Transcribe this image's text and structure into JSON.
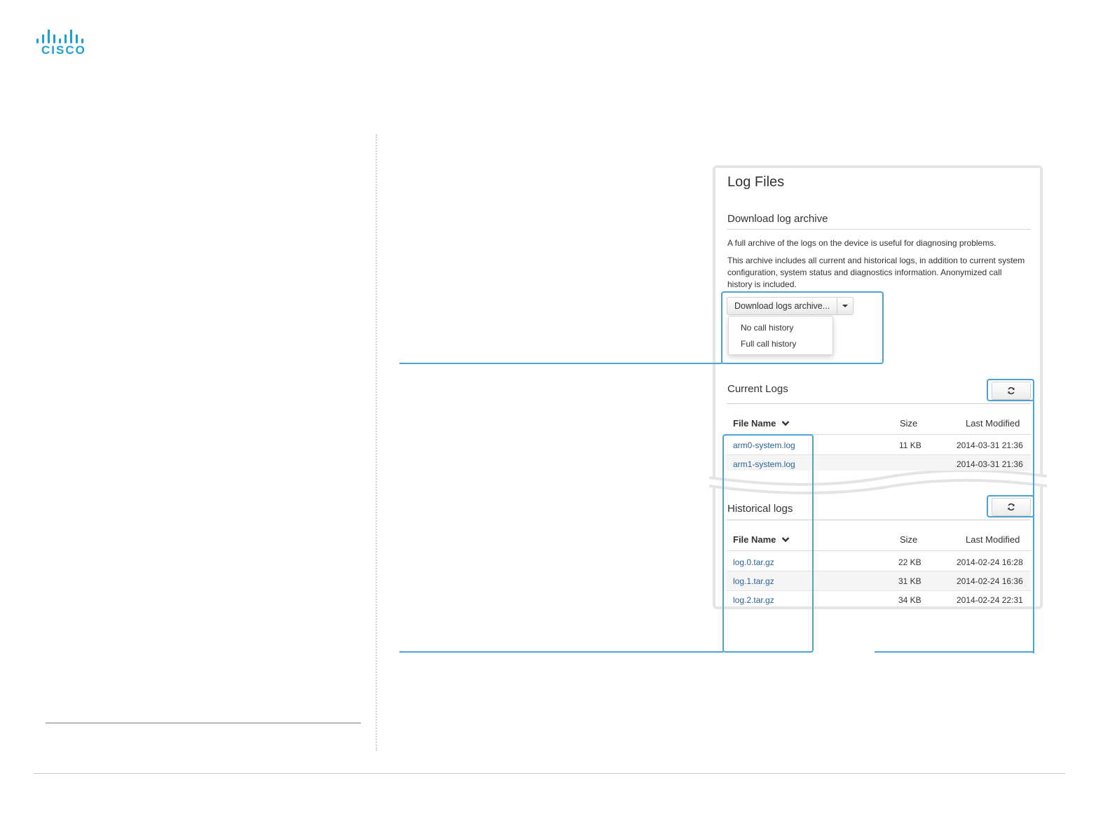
{
  "brand": {
    "logo_text": "CISCO",
    "accent": "#1ba0d7",
    "callout_color": "#4aa3d4",
    "link_color": "#2a6496"
  },
  "panel": {
    "title": "Log Files",
    "download": {
      "heading": "Download log archive",
      "para1": "A full archive of the logs on the device is useful for diagnosing problems.",
      "para2_line1": "This archive includes all current and historical logs, in addition to current system",
      "para2_line2": "configuration, system status and diagnostics information. Anonymized call",
      "para2_line3": "history is included.",
      "button_label": "Download logs archive...",
      "menu": [
        "No call history",
        "Full call history"
      ]
    },
    "current": {
      "heading": "Current Logs",
      "columns": {
        "name": "File Name",
        "size": "Size",
        "modified": "Last Modified"
      },
      "rows": [
        {
          "name": "arm0-system.log",
          "size": "11 KB",
          "modified": "2014-03-31 21:36"
        },
        {
          "name": "arm1-system.log",
          "size": "",
          "modified": "2014-03-31 21:36"
        }
      ]
    },
    "historical": {
      "heading": "Historical logs",
      "columns": {
        "name": "File Name",
        "size": "Size",
        "modified": "Last Modified"
      },
      "rows": [
        {
          "name": "log.0.tar.gz",
          "size": "22 KB",
          "modified": "2014-02-24 16:28"
        },
        {
          "name": "log.1.tar.gz",
          "size": "31 KB",
          "modified": "2014-02-24 16:36"
        },
        {
          "name": "log.2.tar.gz",
          "size": "34 KB",
          "modified": "2014-02-24 22:31"
        }
      ]
    }
  }
}
